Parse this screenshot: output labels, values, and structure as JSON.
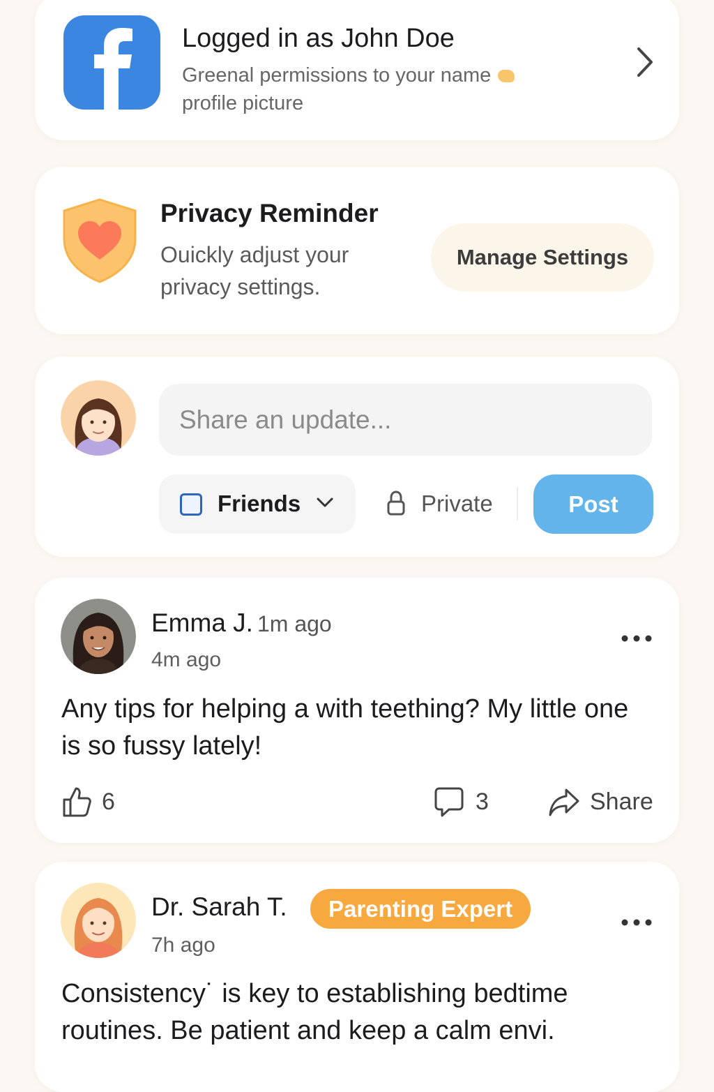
{
  "login": {
    "title": "Logged in as John Doe",
    "subtitle": "Greenal permissions to your name",
    "subtitle_line2": "profile picture"
  },
  "privacy": {
    "title": "Privacy Reminder",
    "description": "Ouickly adjust your privacy settings.",
    "button_label": "Manage Settings"
  },
  "composer": {
    "placeholder": "Share an update...",
    "audience": "Friends",
    "privacy_label": "Private",
    "post_label": "Post"
  },
  "posts": [
    {
      "author": "Emma J.",
      "inline_time": "1m ago",
      "time": "4m ago",
      "body": "Any tips for helping a with teething? My little one is so fussy lately!",
      "likes": "6",
      "comments": "3",
      "share_label": "Share"
    },
    {
      "author": "Dr. Sarah T.",
      "badge": "Parenting Expert",
      "time": "7h ago",
      "body": "Consistency˙ is key to establishing bedtime routines. Be patient and keep a calm envi."
    }
  ],
  "colors": {
    "background": "#fcf7f2",
    "facebook_blue": "#3a86e0",
    "post_button": "#62b4ea",
    "badge_orange": "#f7a83e",
    "shield_orange": "#fcc36c",
    "heart": "#fa7a5a"
  },
  "icons": [
    "facebook-logo-icon",
    "chevron-right-icon",
    "shield-heart-icon",
    "checkbox-icon",
    "chevron-down-icon",
    "lock-icon",
    "more-icon",
    "like-icon",
    "comment-icon",
    "share-icon"
  ]
}
